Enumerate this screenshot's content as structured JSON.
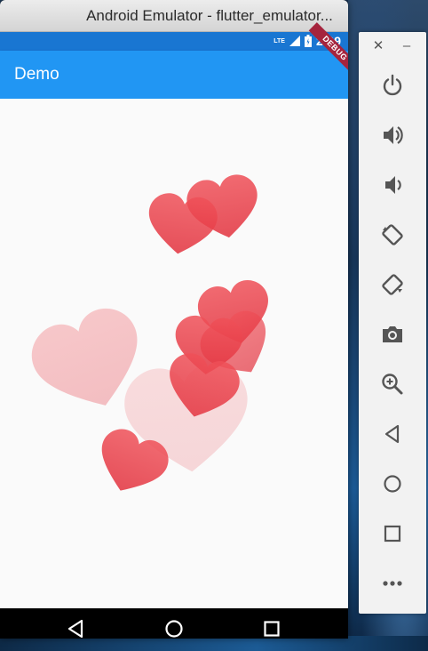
{
  "window": {
    "title": "Android Emulator - flutter_emulator..."
  },
  "statusbar": {
    "network": "LTE",
    "time": "2:09",
    "debug_label": "DEBUG"
  },
  "appbar": {
    "title": "Demo"
  },
  "colors": {
    "appbar": "#2196f3",
    "statusbar": "#1976d2",
    "heart": "#e53945",
    "content_bg": "#fafafa"
  },
  "hearts": [
    {
      "opacity": 0.85
    },
    {
      "opacity": 0.85
    },
    {
      "opacity": 0.85
    },
    {
      "opacity": 0.7
    },
    {
      "opacity": 0.3
    },
    {
      "opacity": 0.85
    },
    {
      "opacity": 0.85
    },
    {
      "opacity": 0.18
    },
    {
      "opacity": 0.85
    }
  ],
  "navbar": {
    "icons": [
      "back-icon",
      "home-icon",
      "overview-icon"
    ]
  },
  "sidepanel": {
    "top": [
      "close-icon",
      "minimize-icon"
    ],
    "buttons": [
      "power-icon",
      "volume-up-icon",
      "volume-down-icon",
      "rotate-left-icon",
      "rotate-right-icon",
      "camera-icon",
      "zoom-icon",
      "back-icon",
      "home-icon",
      "overview-icon",
      "more-icon"
    ]
  }
}
